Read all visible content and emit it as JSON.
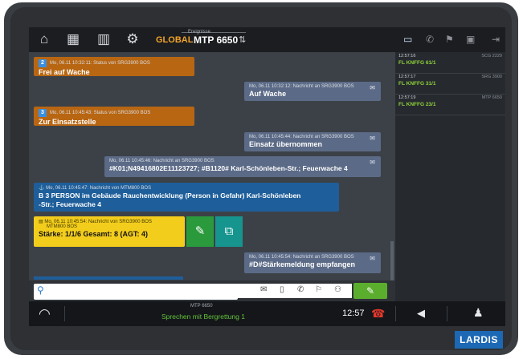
{
  "topbar": {
    "global_label": "GLOBAL",
    "events_label": "Ereignisse",
    "channel": "MTP 6650",
    "icons": [
      "home-icon",
      "calendar-clock-icon",
      "library-icon",
      "gear-icon"
    ],
    "right_icons": [
      "chat-icon",
      "phone-icon",
      "flag-icon",
      "device-icon",
      "exit-icon"
    ]
  },
  "messages": [
    {
      "num": "2",
      "meta": "Mo, 06.11 10:32:11: Status von SRG3900 BOS",
      "body": "Frei auf Wache",
      "color": "#b86612"
    },
    {
      "meta": "Mo, 06.11 10:32:12: Nachricht an SRG3900 BOS",
      "body": "Auf Wache",
      "color": "#5b6a86"
    },
    {
      "num": "3",
      "meta": "Mo, 06.11 10:45:43: Status von SRG3900 BOS",
      "body": "Zur Einsatzstelle",
      "color": "#b86612"
    },
    {
      "meta": "Mo, 06.11 10:45:44: Nachricht an SRG3900 BOS",
      "body": "Einsatz übernommen",
      "color": "#5b6a86"
    },
    {
      "meta": "Mo, 06.11 10:45:46: Nachricht an SRG3900 BOS",
      "body": "#K01;N49416802E11123727; #B1120# Karl-Schönleben-Str.; Feuerwache 4",
      "color": "#5b6a86"
    },
    {
      "meta": "Mo, 06.11 10:45:47: Nachricht von MTM800 BOS",
      "body_line1": "B 3 PERSON im Gebäude Rauchentwicklung (Person in Gefahr) Karl-Schönleben",
      "body_line2": "-Str.; Feuerwache 4",
      "color": "#1e5e9a"
    },
    {
      "meta": "Mo, 06.11 10:45:54: Nachricht von SRG3900 BOS",
      "meta2": "MTM800 BOS",
      "body": "Stärke: 1/1/6 Gesamt: 8 (AGT: 4)",
      "color": "#f3cd1c"
    },
    {
      "meta": "Mo, 06.11 10:45:54: Nachricht an SRG3900 BOS",
      "body": "#D#Stärkemeldung empfangen",
      "color": "#5b6a86"
    }
  ],
  "events": [
    {
      "time": "12:57:16",
      "source": "SCG 2229",
      "title": "FL KNFFG 61/1"
    },
    {
      "time": "12:57:17",
      "source": "SRG 3900",
      "title": "FL KNFFG 31/1"
    },
    {
      "time": "12:57:19",
      "source": "MTP 6650",
      "title": "FL KNFFG 23/1"
    }
  ],
  "search": {
    "placeholder": ""
  },
  "bottombar": {
    "mtp_label": "MTP 6650",
    "status": "Sprechen mit Bergrettung 1",
    "time": "12:57"
  },
  "logo": "LARDIS",
  "colors": {
    "accent_orange": "#f2a32b",
    "status_green": "#64c43a",
    "event_green": "#8fd13a"
  }
}
